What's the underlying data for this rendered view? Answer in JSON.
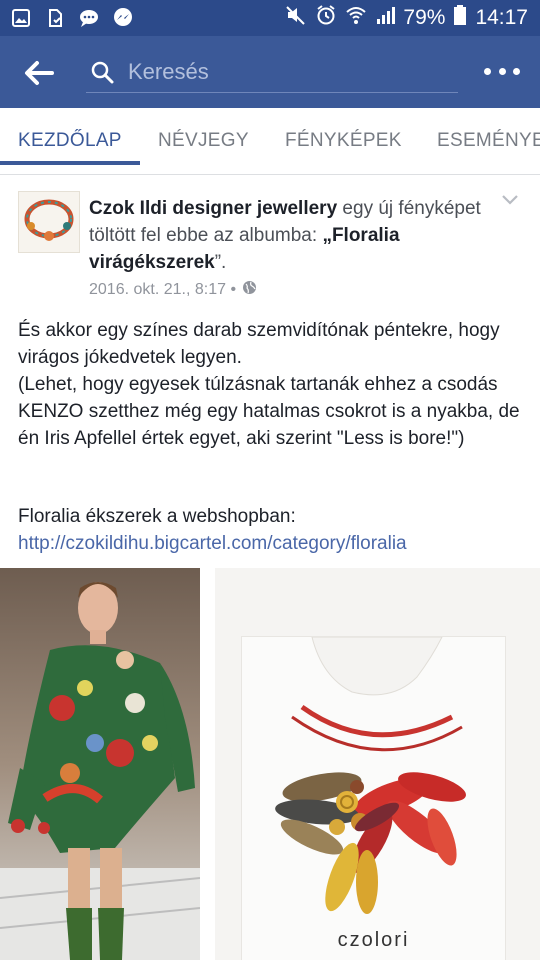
{
  "status_bar": {
    "battery": "79%",
    "time": "14:17",
    "left_icons": [
      "image-icon",
      "file-icon",
      "chat-bubble-icon",
      "messenger-icon"
    ],
    "right_icons": [
      "mute-icon",
      "alarm-icon",
      "wifi-icon",
      "signal-icon",
      "battery-icon"
    ]
  },
  "app_bar": {
    "search_placeholder": "Keresés"
  },
  "tabs": [
    {
      "label": "KEZDŐLAP"
    },
    {
      "label": "NÉVJEGY"
    },
    {
      "label": "FÉNYKÉPEK"
    },
    {
      "label": "ESEMÉNYEK"
    }
  ],
  "post": {
    "author": "Czok Ildi designer jewellery",
    "action": " egy új fényképet töltött fel ebbe az albumba: ",
    "album": "„Floralia virágékszerek",
    "album_end": "”.",
    "date": "2016. okt. 21., 8:17 •",
    "body": "És akkor egy színes darab szemvidítónak péntekre, hogy virágos jókedvetek legyen.\n(Lehet, hogy egyesek túlzásnak tartanák ehhez a csodás KENZO szetthez még egy hatalmas csokrot is a nyakba, de én Iris Apfellel értek egyet, aki szerint \"Less is bore!\")",
    "link_prefix": "Floralia ékszerek a webshopban: ",
    "link": "http://czokildihu.bigcartel.com/category/floralia",
    "brand": "czolori"
  },
  "colors": {
    "header_blue": "#3b5998",
    "status_blue": "#2c4a8a",
    "link_blue": "#4a67a8"
  }
}
